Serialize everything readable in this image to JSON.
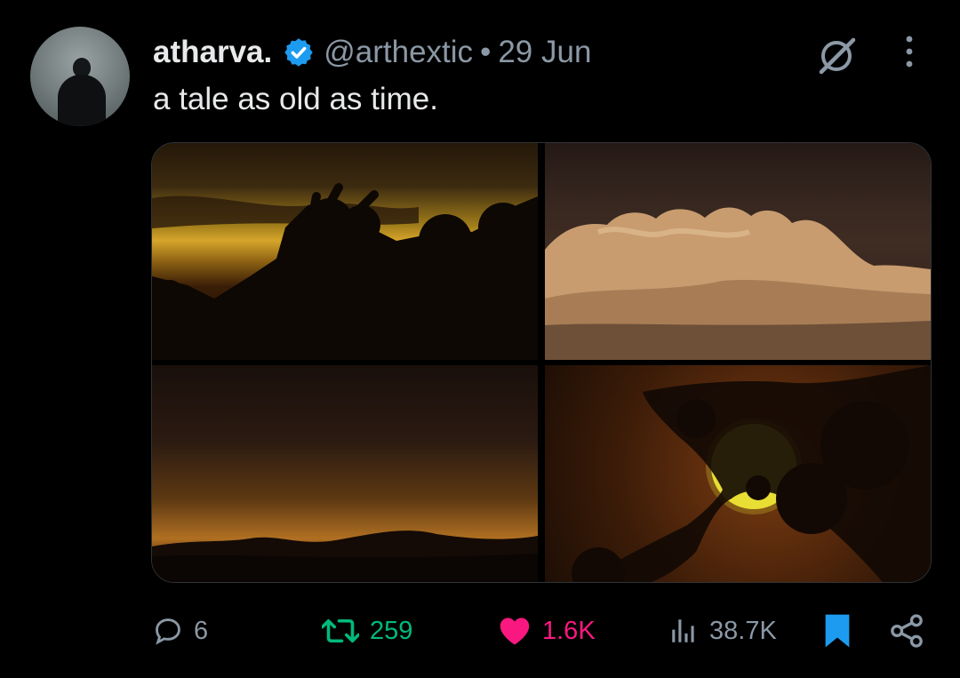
{
  "tweet": {
    "author": {
      "name": "atharva.",
      "verified": true,
      "handle": "@arthextic",
      "separator": "•",
      "date": "29 Jun",
      "avatar": "person-silhouette-avatar"
    },
    "text": "a tale as old as time.",
    "media": [
      {
        "id": "photo-1",
        "subject": "sunset-trees-silhouette"
      },
      {
        "id": "photo-2",
        "subject": "cumulus-clouds"
      },
      {
        "id": "photo-3",
        "subject": "dusk-horizon"
      },
      {
        "id": "photo-4",
        "subject": "sun-behind-branches"
      }
    ],
    "actions": {
      "replies": "6",
      "reposts": "259",
      "likes": "1.6K",
      "views": "38.7K",
      "bookmarked": true,
      "liked": true
    },
    "icons": {
      "verified": "verified-badge-icon",
      "grok": "grok-icon",
      "more": "more-vertical-icon",
      "reply": "reply-icon",
      "repost": "repost-icon",
      "like": "heart-icon",
      "views": "views-chart-icon",
      "bookmark": "bookmark-icon",
      "share": "share-icon"
    },
    "colors": {
      "background": "#000000",
      "text": "#e7e9ea",
      "muted": "#8b98a5",
      "verified": "#1d9bf0",
      "repost": "#00ba7c",
      "like": "#f91880",
      "bookmark": "#1d9bf0"
    }
  }
}
